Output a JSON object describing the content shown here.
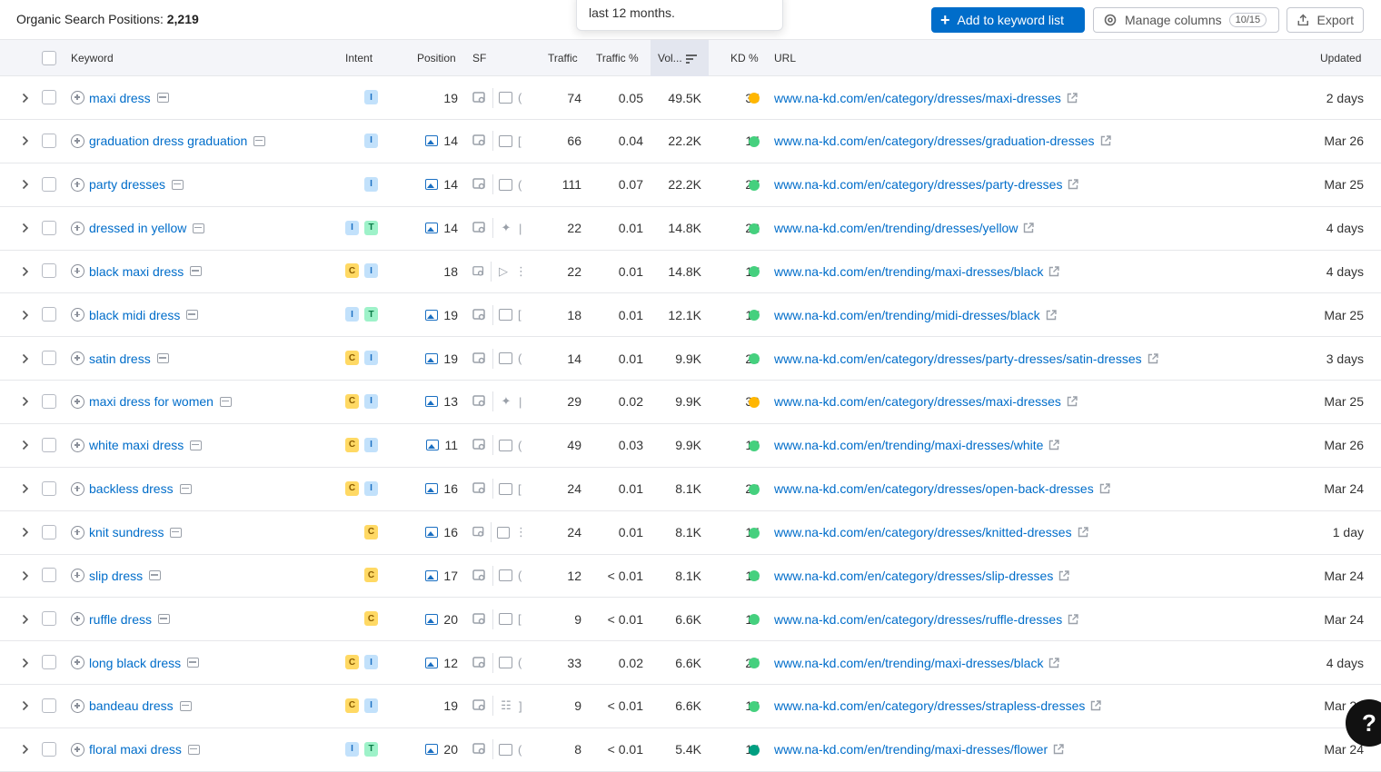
{
  "header": {
    "title_prefix": "Organic Search Positions:",
    "title_count": "2,219",
    "tooltip_text": "last 12 months.",
    "add_button": "Add to keyword list",
    "manage_button": "Manage columns",
    "manage_count": "10/15",
    "export_button": "Export"
  },
  "columns": {
    "keyword": "Keyword",
    "intent": "Intent",
    "position": "Position",
    "sf": "SF",
    "traffic": "Traffic",
    "traffic_pct": "Traffic %",
    "volume": "Vol...",
    "kd": "KD %",
    "url": "URL",
    "updated": "Updated"
  },
  "colors": {
    "accent": "#006dca",
    "kd_yellow": "#ffb600",
    "kd_green": "#45d07e",
    "kd_teal": "#009f81"
  },
  "rows": [
    {
      "keyword": "maxi dress",
      "intents": [
        "I"
      ],
      "img": false,
      "position": "19",
      "sf2": "image",
      "sf3": "(",
      "traffic": "74",
      "traffic_pct": "0.05",
      "volume": "49.5K",
      "kd": "35",
      "kd_color": "#ffb600",
      "url": "www.na-kd.com/en/category/dresses/maxi-dresses",
      "updated": "2 days"
    },
    {
      "keyword": "graduation dress graduation",
      "intents": [
        "I"
      ],
      "img": true,
      "position": "14",
      "sf2": "image",
      "sf3": "[",
      "traffic": "66",
      "traffic_pct": "0.04",
      "volume": "22.2K",
      "kd": "15",
      "kd_color": "#45d07e",
      "url": "www.na-kd.com/en/category/dresses/graduation-dresses",
      "updated": "Mar 26"
    },
    {
      "keyword": "party dresses",
      "intents": [
        "I"
      ],
      "img": true,
      "position": "14",
      "sf2": "image",
      "sf3": "(",
      "traffic": "111",
      "traffic_pct": "0.07",
      "volume": "22.2K",
      "kd": "27",
      "kd_color": "#45d07e",
      "url": "www.na-kd.com/en/category/dresses/party-dresses",
      "updated": "Mar 25"
    },
    {
      "keyword": "dressed in yellow",
      "intents": [
        "I",
        "T"
      ],
      "img": true,
      "position": "14",
      "sf2": "sparkle",
      "sf3": "|",
      "traffic": "22",
      "traffic_pct": "0.01",
      "volume": "14.8K",
      "kd": "22",
      "kd_color": "#45d07e",
      "url": "www.na-kd.com/en/trending/dresses/yellow",
      "updated": "4 days"
    },
    {
      "keyword": "black maxi dress",
      "intents": [
        "C",
        "I"
      ],
      "img": false,
      "position": "18",
      "sf2": "play",
      "sf3": "⋮",
      "traffic": "22",
      "traffic_pct": "0.01",
      "volume": "14.8K",
      "kd": "17",
      "kd_color": "#45d07e",
      "url": "www.na-kd.com/en/trending/maxi-dresses/black",
      "updated": "4 days"
    },
    {
      "keyword": "black midi dress",
      "intents": [
        "I",
        "T"
      ],
      "img": true,
      "position": "19",
      "sf2": "image",
      "sf3": "[",
      "traffic": "18",
      "traffic_pct": "0.01",
      "volume": "12.1K",
      "kd": "17",
      "kd_color": "#45d07e",
      "url": "www.na-kd.com/en/trending/midi-dresses/black",
      "updated": "Mar 25"
    },
    {
      "keyword": "satin dress",
      "intents": [
        "C",
        "I"
      ],
      "img": true,
      "position": "19",
      "sf2": "image",
      "sf3": "(",
      "traffic": "14",
      "traffic_pct": "0.01",
      "volume": "9.9K",
      "kd": "24",
      "kd_color": "#45d07e",
      "url": "www.na-kd.com/en/category/dresses/party-dresses/satin-dresses",
      "updated": "3 days"
    },
    {
      "keyword": "maxi dress for women",
      "intents": [
        "C",
        "I"
      ],
      "img": true,
      "position": "13",
      "sf2": "sparkle",
      "sf3": "|",
      "traffic": "29",
      "traffic_pct": "0.02",
      "volume": "9.9K",
      "kd": "39",
      "kd_color": "#ffb600",
      "url": "www.na-kd.com/en/category/dresses/maxi-dresses",
      "updated": "Mar 25"
    },
    {
      "keyword": "white maxi dress",
      "intents": [
        "C",
        "I"
      ],
      "img": true,
      "position": "11",
      "sf2": "image",
      "sf3": "(",
      "traffic": "49",
      "traffic_pct": "0.03",
      "volume": "9.9K",
      "kd": "16",
      "kd_color": "#45d07e",
      "url": "www.na-kd.com/en/trending/maxi-dresses/white",
      "updated": "Mar 26"
    },
    {
      "keyword": "backless dress",
      "intents": [
        "C",
        "I"
      ],
      "img": true,
      "position": "16",
      "sf2": "image",
      "sf3": "[",
      "traffic": "24",
      "traffic_pct": "0.01",
      "volume": "8.1K",
      "kd": "20",
      "kd_color": "#45d07e",
      "url": "www.na-kd.com/en/category/dresses/open-back-dresses",
      "updated": "Mar 24"
    },
    {
      "keyword": "knit sundress",
      "intents": [
        "C"
      ],
      "img": true,
      "position": "16",
      "sf2": "image",
      "sf3": "⋮",
      "traffic": "24",
      "traffic_pct": "0.01",
      "volume": "8.1K",
      "kd": "15",
      "kd_color": "#45d07e",
      "url": "www.na-kd.com/en/category/dresses/knitted-dresses",
      "updated": "1 day"
    },
    {
      "keyword": "slip dress",
      "intents": [
        "C"
      ],
      "img": true,
      "position": "17",
      "sf2": "image",
      "sf3": "(",
      "traffic": "12",
      "traffic_pct": "< 0.01",
      "volume": "8.1K",
      "kd": "18",
      "kd_color": "#45d07e",
      "url": "www.na-kd.com/en/category/dresses/slip-dresses",
      "updated": "Mar 24"
    },
    {
      "keyword": "ruffle dress",
      "intents": [
        "C"
      ],
      "img": true,
      "position": "20",
      "sf2": "image",
      "sf3": "[",
      "traffic": "9",
      "traffic_pct": "< 0.01",
      "volume": "6.6K",
      "kd": "16",
      "kd_color": "#45d07e",
      "url": "www.na-kd.com/en/category/dresses/ruffle-dresses",
      "updated": "Mar 24"
    },
    {
      "keyword": "long black dress",
      "intents": [
        "C",
        "I"
      ],
      "img": true,
      "position": "12",
      "sf2": "image",
      "sf3": "(",
      "traffic": "33",
      "traffic_pct": "0.02",
      "volume": "6.6K",
      "kd": "25",
      "kd_color": "#45d07e",
      "url": "www.na-kd.com/en/trending/maxi-dresses/black",
      "updated": "4 days"
    },
    {
      "keyword": "bandeau dress",
      "intents": [
        "C",
        "I"
      ],
      "img": false,
      "position": "19",
      "sf2": "list",
      "sf3": "]",
      "traffic": "9",
      "traffic_pct": "< 0.01",
      "volume": "6.6K",
      "kd": "16",
      "kd_color": "#45d07e",
      "url": "www.na-kd.com/en/category/dresses/strapless-dresses",
      "updated": "Mar 24"
    },
    {
      "keyword": "floral maxi dress",
      "intents": [
        "I",
        "T"
      ],
      "img": true,
      "position": "20",
      "sf2": "image",
      "sf3": "(",
      "traffic": "8",
      "traffic_pct": "< 0.01",
      "volume": "5.4K",
      "kd": "14",
      "kd_color": "#009f81",
      "url": "www.na-kd.com/en/trending/maxi-dresses/flower",
      "updated": "Mar 24"
    }
  ],
  "help_label": "?"
}
